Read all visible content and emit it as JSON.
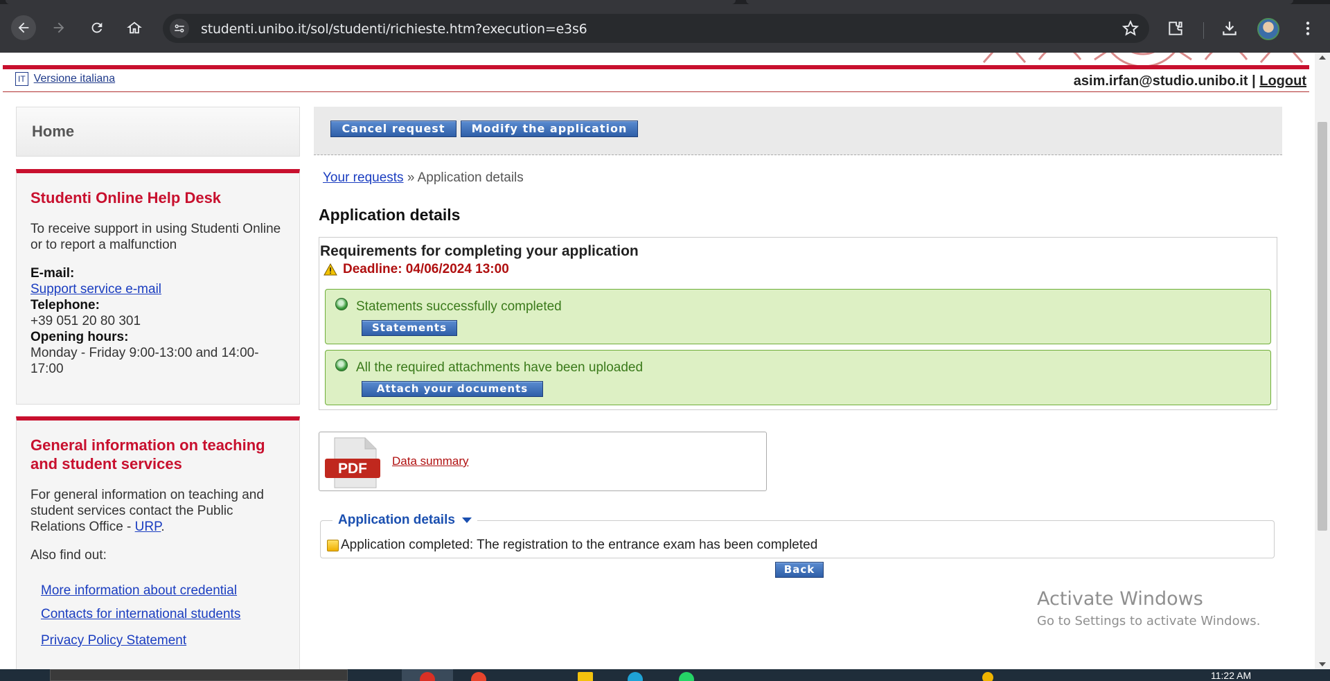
{
  "browser": {
    "url": "studenti.unibo.it/sol/studenti/richieste.htm?execution=e3s6"
  },
  "header": {
    "lang_badge": "IT",
    "lang_link": "Versione italiana",
    "user_email": "asim.irfan@studio.unibo.it",
    "separator": "|",
    "logout": "Logout"
  },
  "sidebar": {
    "home": "Home",
    "help": {
      "title": "Studenti Online Help Desk",
      "intro": "To receive support in using Studenti Online or to report a malfunction",
      "email_label": "E-mail:",
      "email_link": "Support service e-mail",
      "phone_label": "Telephone:",
      "phone_value": "+39 051 20 80 301",
      "hours_label": "Opening hours:",
      "hours_value": "Monday - Friday 9:00-13:00 and 14:00-17:00"
    },
    "info": {
      "title": "General information on teaching and student services",
      "text": "For general information on teaching and student services contact the Public Relations Office - ",
      "urp_link": "URP",
      "period": ".",
      "find_out": "Also find out:",
      "links": [
        "More information about credential",
        "Contacts for international students",
        "Privacy Policy Statement"
      ]
    }
  },
  "main": {
    "cancel_button": "Cancel request",
    "modify_button": "Modify the application",
    "breadcrumb_link": "Your requests",
    "breadcrumb_current": " » Application details",
    "title": "Application details",
    "requirements_title": "Requirements for completing your application",
    "deadline": "Deadline: 04/06/2024 13:00",
    "statements_msg": "Statements successfully completed",
    "statements_button": "Statements",
    "attachments_msg": "All the required attachments have been uploaded",
    "attach_button": "Attach your documents",
    "pdf_label": "PDF",
    "data_summary_link": "Data summary",
    "details_legend": "Application details",
    "completed_text": "Application completed: The registration to the entrance exam has been completed",
    "back_button": "Back"
  },
  "watermark": {
    "line1": "Activate Windows",
    "line2": "Go to Settings to activate Windows."
  },
  "taskbar": {
    "clock": "11:22 AM"
  },
  "colors": {
    "brand_red": "#c8102e",
    "link_blue": "#1a3dc0",
    "success_green": "#ddf0c4",
    "button_blue": "#2f5fa8"
  }
}
